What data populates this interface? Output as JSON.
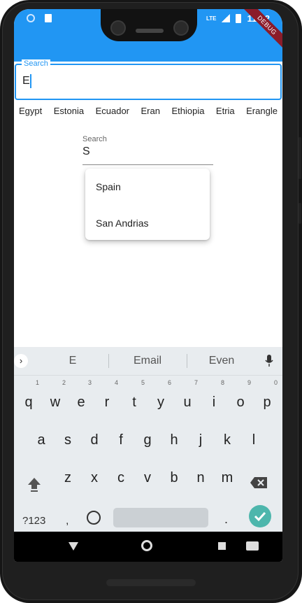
{
  "status_bar": {
    "time": "11:12",
    "network": "LTE"
  },
  "debug_banner": "DEBUG",
  "search_field": {
    "label": "Search",
    "value": "E"
  },
  "chips": [
    "Egypt",
    "Estonia",
    "Ecuador",
    "Eran",
    "Ethiopia",
    "Etria",
    "Erangle"
  ],
  "search_field_2": {
    "label": "Search",
    "value": "S"
  },
  "dropdown": {
    "items": [
      "Spain",
      "San Andrias"
    ]
  },
  "keyboard": {
    "suggestions": [
      "E",
      "Email",
      "Even"
    ],
    "row1": [
      "q",
      "w",
      "e",
      "r",
      "t",
      "y",
      "u",
      "i",
      "o",
      "p"
    ],
    "row1_hints": [
      "1",
      "2",
      "3",
      "4",
      "5",
      "6",
      "7",
      "8",
      "9",
      "0"
    ],
    "row2": [
      "a",
      "s",
      "d",
      "f",
      "g",
      "h",
      "j",
      "k",
      "l"
    ],
    "row3": [
      "z",
      "x",
      "c",
      "v",
      "b",
      "n",
      "m"
    ],
    "num_label": "?123",
    "comma": ",",
    "period": "."
  },
  "icons": {
    "expander": "chevron-right-icon",
    "mic": "mic-icon",
    "shift": "shift-icon",
    "backspace": "backspace-icon",
    "emoji": "emoji-icon",
    "done": "check-icon"
  },
  "colors": {
    "app_bar": "#2196f3",
    "accent": "#2196f3",
    "keyboard_bg": "#e8ecef",
    "done_key": "#4db6ac"
  }
}
